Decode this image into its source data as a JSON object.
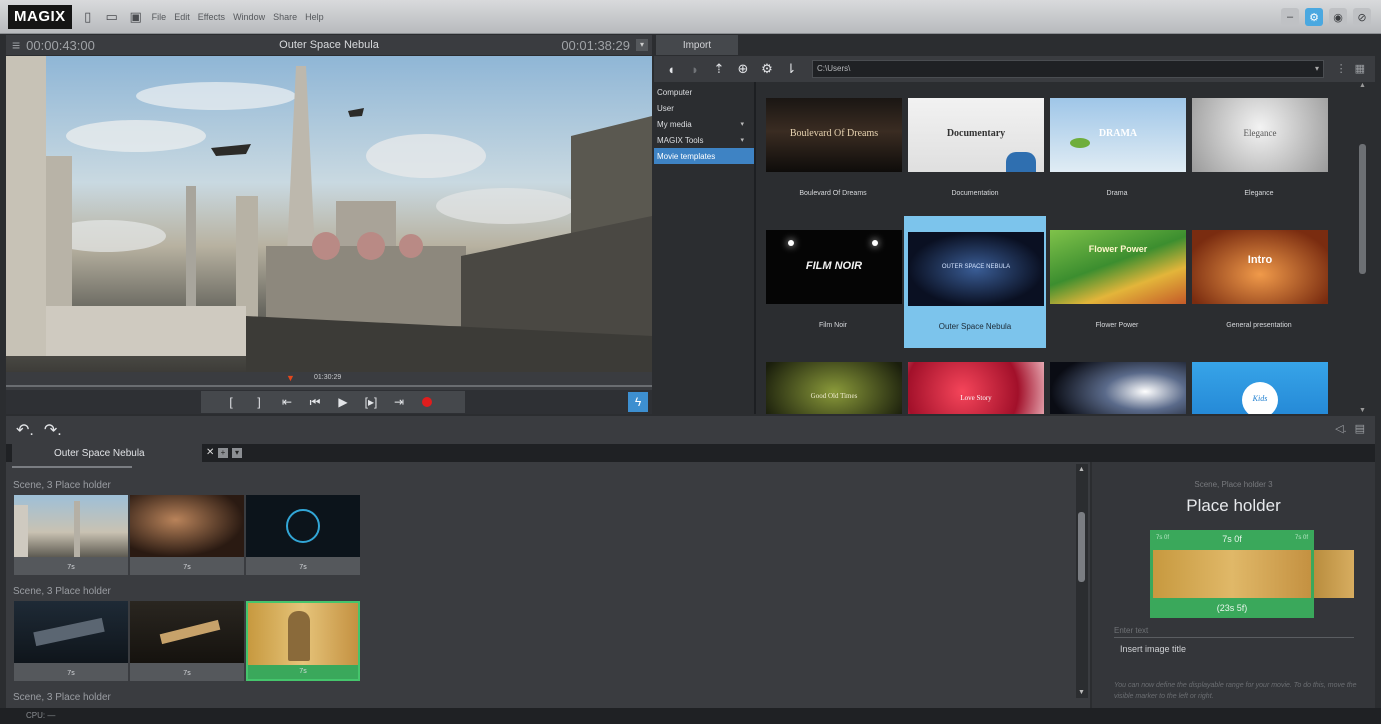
{
  "app": {
    "logo": "MAGIX",
    "menu": [
      "File",
      "Edit",
      "Effects",
      "Window",
      "Share",
      "Help"
    ]
  },
  "preview": {
    "timecode_current": "00:00:43:00",
    "title": "Outer Space Nebula",
    "timecode_total": "00:01:38:29",
    "scrub_time": "01:30:29",
    "transport": [
      "[",
      "]",
      "⇤",
      "⏮",
      "▶",
      "[▸]",
      "⇥"
    ]
  },
  "import": {
    "tab": "Import",
    "path": "C:\\Users\\",
    "tree": [
      {
        "label": "Computer",
        "arrow": false
      },
      {
        "label": "User",
        "arrow": false
      },
      {
        "label": "My media",
        "arrow": true
      },
      {
        "label": "MAGIX Tools",
        "arrow": true
      },
      {
        "label": "Movie templates",
        "arrow": false,
        "selected": true
      }
    ],
    "templates": [
      {
        "name": "Boulevard Of Dreams",
        "thumb_text": "Boulevard Of Dreams"
      },
      {
        "name": "Documentation",
        "thumb_text": "Documentary"
      },
      {
        "name": "Drama",
        "thumb_text": "DRAMA"
      },
      {
        "name": "Elegance",
        "thumb_text": "Elegance"
      },
      {
        "name": "Film Noir",
        "thumb_text": "FILM NOIR"
      },
      {
        "name": "Outer Space Nebula",
        "thumb_text": "OUTER SPACE NEBULA"
      },
      {
        "name": "Flower Power",
        "thumb_text": "Flower Power"
      },
      {
        "name": "General presentation",
        "thumb_text": "Intro"
      },
      {
        "name": "",
        "thumb_text": "Good Old Times"
      },
      {
        "name": "",
        "thumb_text": "Love Story"
      },
      {
        "name": "",
        "thumb_text": ""
      },
      {
        "name": "",
        "thumb_text": "Kids"
      }
    ]
  },
  "storyboard": {
    "tab": "Outer Space Nebula",
    "scenes": [
      {
        "label": "Scene, 3 Place holder",
        "clips": [
          {
            "duration": "7s"
          },
          {
            "duration": "7s"
          },
          {
            "duration": "7s"
          }
        ]
      },
      {
        "label": "Scene, 3 Place holder",
        "clips": [
          {
            "duration": "7s"
          },
          {
            "duration": "7s"
          },
          {
            "duration": "7s",
            "selected": true
          }
        ]
      },
      {
        "label": "Scene, 3 Place holder",
        "clips": []
      }
    ]
  },
  "inspector": {
    "subtitle": "Scene, Place holder 3",
    "title": "Place holder",
    "range_left": "7s 0f",
    "range_center": "7s 0f",
    "range_right": "7s 0f",
    "range_total": "(23s 5f)",
    "input_placeholder": "Enter text",
    "caption": "Insert image title",
    "note": "You can now define the displayable range for your movie. To do this, move the visible marker to the left or right."
  },
  "status": {
    "zoom": "CPU: ―"
  },
  "colors": {
    "accent_blue": "#3e83c4",
    "selection_green": "#3aa85b",
    "record_red": "#e11d1d"
  }
}
